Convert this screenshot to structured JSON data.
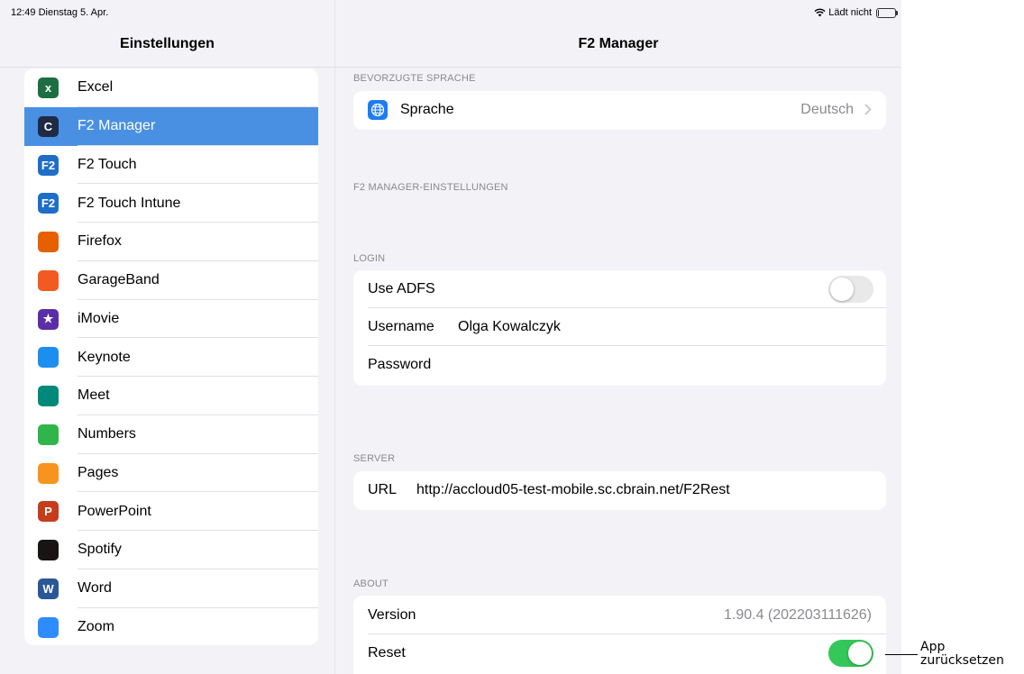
{
  "status_bar": {
    "time_date": "12:49  Dienstag 5. Apr.",
    "charging": "Lädt nicht",
    "battery_level": 0.05,
    "wifi_icon": "wifi-icon"
  },
  "sidebar": {
    "title": "Einstellungen",
    "selected": "F2 Manager",
    "items": [
      {
        "label": "Excel",
        "icon": "excel-icon",
        "glyph": "x",
        "color": "#1d6f42"
      },
      {
        "label": "F2 Manager",
        "icon": "f2-manager-icon",
        "glyph": "C",
        "color": "#1f2a44"
      },
      {
        "label": "F2 Touch",
        "icon": "f2-touch-icon",
        "glyph": "F2",
        "color": "#1e6ec8"
      },
      {
        "label": "F2 Touch Intune",
        "icon": "f2-touch-intune-icon",
        "glyph": "F2",
        "color": "#1e6ec8"
      },
      {
        "label": "Firefox",
        "icon": "firefox-icon",
        "glyph": "",
        "color": "#e66000"
      },
      {
        "label": "GarageBand",
        "icon": "garageband-icon",
        "glyph": "",
        "color": "#f25a22"
      },
      {
        "label": "iMovie",
        "icon": "imovie-icon",
        "glyph": "★",
        "color": "#5b2ea6"
      },
      {
        "label": "Keynote",
        "icon": "keynote-icon",
        "glyph": "",
        "color": "#1c8ef0"
      },
      {
        "label": "Meet",
        "icon": "meet-icon",
        "glyph": "",
        "color": "#00897b"
      },
      {
        "label": "Numbers",
        "icon": "numbers-icon",
        "glyph": "",
        "color": "#2fb54a"
      },
      {
        "label": "Pages",
        "icon": "pages-icon",
        "glyph": "",
        "color": "#f7941d"
      },
      {
        "label": "PowerPoint",
        "icon": "powerpoint-icon",
        "glyph": "P",
        "color": "#c43e1c"
      },
      {
        "label": "Spotify",
        "icon": "spotify-icon",
        "glyph": "",
        "color": "#191414"
      },
      {
        "label": "Word",
        "icon": "word-icon",
        "glyph": "W",
        "color": "#2b5797"
      },
      {
        "label": "Zoom",
        "icon": "zoom-icon",
        "glyph": "",
        "color": "#2d8cff"
      }
    ]
  },
  "detail": {
    "title": "F2 Manager",
    "language": {
      "header": "BEVORZUGTE SPRACHE",
      "label": "Sprache",
      "value": "Deutsch",
      "icon": "globe-icon"
    },
    "f2_settings_header": "F2 MANAGER-EINSTELLUNGEN",
    "login": {
      "header": "LOGIN",
      "use_adfs_label": "Use ADFS",
      "use_adfs_on": false,
      "username_label": "Username",
      "username_value": "Olga Kowalczyk",
      "password_label": "Password"
    },
    "server": {
      "header": "SERVER",
      "url_label": "URL",
      "url_value": "http://accloud05-test-mobile.sc.cbrain.net/F2Rest"
    },
    "about": {
      "header": "ABOUT",
      "version_label": "Version",
      "version_value": "1.90.4 (202203111626)",
      "reset_label": "Reset",
      "reset_on": true
    }
  },
  "annotation": {
    "line1": "App",
    "line2": "zurücksetzen"
  },
  "colors": {
    "selection": "#4a90e2",
    "toggle_on": "#34c759",
    "toggle_off": "#e9e9ea",
    "background": "#f2f2f7"
  }
}
